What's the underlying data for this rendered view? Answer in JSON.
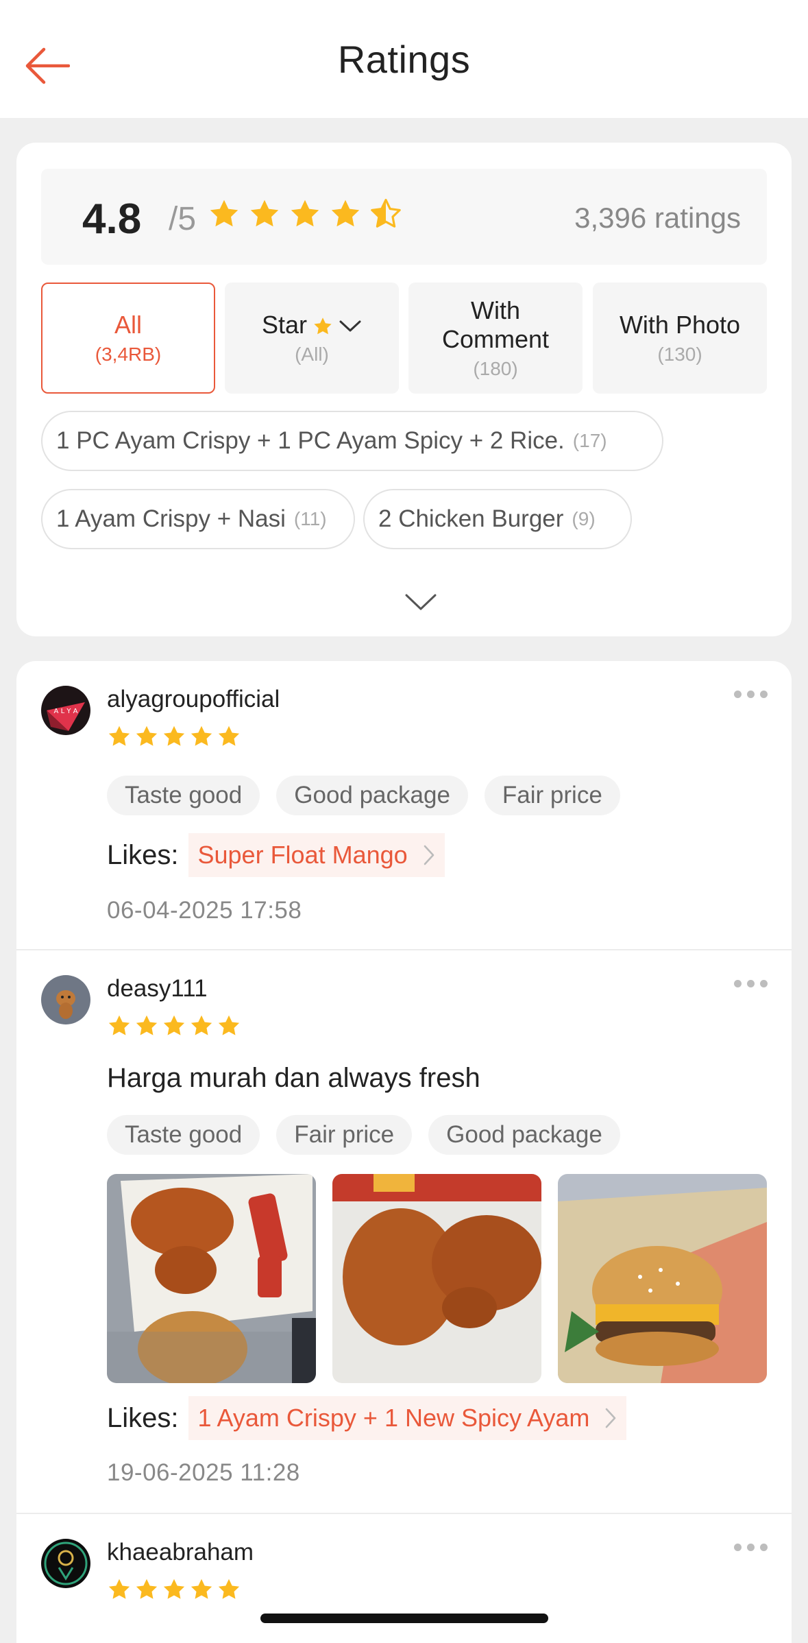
{
  "header": {
    "title": "Ratings"
  },
  "summary": {
    "score": "4.8",
    "score_max": "/5",
    "count_text": "3,396 ratings",
    "stars": 4.5
  },
  "filters": [
    {
      "label": "All",
      "count": "(3,4RB)",
      "active": true
    },
    {
      "label": "Star",
      "count": "(All)"
    },
    {
      "label": "With Comment",
      "count": "(180)"
    },
    {
      "label": "With Photo",
      "count": "(130)"
    }
  ],
  "menu_filters": [
    {
      "label": "1 PC Ayam Crispy + 1 PC Ayam Spicy + 2 Rice.",
      "count": "(17)"
    },
    {
      "label": "1 Ayam Crispy + Nasi",
      "count": "(11)"
    },
    {
      "label": "2 Chicken Burger",
      "count": "(9)"
    }
  ],
  "reviews": [
    {
      "username": "alyagroupofficial",
      "stars": 5,
      "tags": [
        "Taste good",
        "Good package",
        "Fair price"
      ],
      "likes_label": "Likes:",
      "likes_item": "Super Float Mango",
      "date": "06-04-2025 17:58"
    },
    {
      "username": "deasy111",
      "stars": 5,
      "comment": "Harga murah dan always fresh",
      "tags": [
        "Taste good",
        "Fair price",
        "Good package"
      ],
      "photos": [
        "fried-chicken-box-photo",
        "fried-chicken-pieces-photo",
        "burger-photo"
      ],
      "likes_label": "Likes:",
      "likes_item": "1 Ayam Crispy + 1 New Spicy Ayam",
      "date": "19-06-2025 11:28"
    },
    {
      "username": "khaeabraham",
      "stars": 5
    }
  ],
  "colors": {
    "accent": "#e9583a",
    "star": "#fbb91f",
    "background": "#efefef"
  }
}
